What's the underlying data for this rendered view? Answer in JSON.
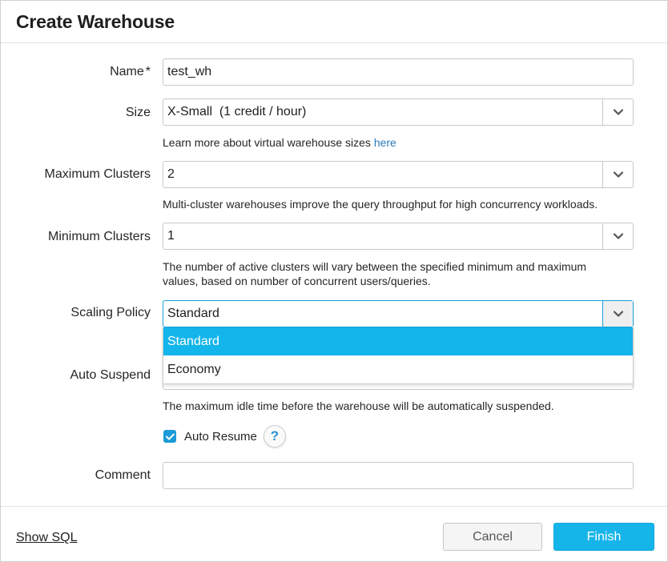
{
  "dialog": {
    "title": "Create Warehouse"
  },
  "form": {
    "name": {
      "label": "Name",
      "required_mark": "*",
      "value": "test_wh"
    },
    "size": {
      "label": "Size",
      "value": "X-Small  (1 credit / hour)",
      "help_text": "Learn more about virtual warehouse sizes ",
      "help_link": "here"
    },
    "max_clusters": {
      "label": "Maximum Clusters",
      "value": "2",
      "help_text": "Multi-cluster warehouses improve the query throughput for high concurrency workloads."
    },
    "min_clusters": {
      "label": "Minimum Clusters",
      "value": "1",
      "help_text": "The number of active clusters will vary between the specified minimum and maximum values, based on number of concurrent users/queries."
    },
    "scaling_policy": {
      "label": "Scaling Policy",
      "value": "Standard",
      "options": [
        "Standard",
        "Economy"
      ],
      "highlighted_option": "Standard"
    },
    "auto_suspend": {
      "label": "Auto Suspend",
      "help_text": "The maximum idle time before the warehouse will be automatically suspended."
    },
    "auto_resume": {
      "label": "Auto Resume",
      "checked": true,
      "help_icon": "?"
    },
    "comment": {
      "label": "Comment",
      "value": ""
    }
  },
  "footer": {
    "show_sql": "Show SQL",
    "cancel": "Cancel",
    "finish": "Finish"
  },
  "colors": {
    "accent": "#15b5ea",
    "focus_border": "#1b9ed8",
    "link": "#2a7ab8",
    "checkbox": "#1a9ad6"
  },
  "icons": {
    "dropdown": "chevron-down-icon",
    "checkbox": "checkmark-icon",
    "help": "question-mark-icon"
  }
}
